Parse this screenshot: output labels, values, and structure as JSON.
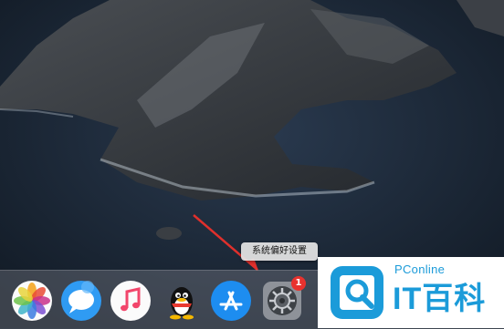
{
  "tooltip": {
    "text": "系统偏好设置"
  },
  "dock": {
    "items": [
      {
        "name": "photos-icon"
      },
      {
        "name": "messages-icon"
      },
      {
        "name": "music-icon"
      },
      {
        "name": "qq-icon"
      },
      {
        "name": "app-store-icon"
      },
      {
        "name": "system-preferences-icon",
        "badge": "1"
      }
    ]
  },
  "watermark": {
    "small": "PConline",
    "big": "IT百科"
  },
  "colors": {
    "wallpaper": "#16202c",
    "badge": "#e8322e",
    "brand": "#1b9bd9"
  }
}
